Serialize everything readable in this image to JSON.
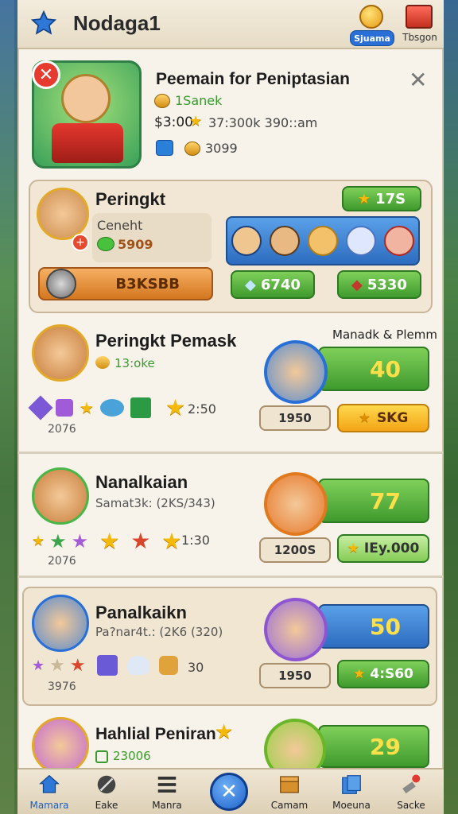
{
  "header": {
    "title": "Nodaga1",
    "btn1_label": "Sjuama",
    "btn2_label": "Tbsgon"
  },
  "card": {
    "title": "Peemain for Peniptasian",
    "coin_text": "1Sanek",
    "price": "$3:00",
    "time": "37:300k 390::am",
    "count": "3099"
  },
  "profile": {
    "name": "Peringkt",
    "sub": "Ceneht",
    "gems": "5909",
    "action": "B3KSBB",
    "stars": "17S",
    "gems_a": "6740",
    "gems_b": "5330"
  },
  "rows": [
    {
      "name": "Peringkt Pemask",
      "sub": "13:oke",
      "label_right": "Manadk & Plemm",
      "score": "40",
      "tag": "1950",
      "btn": "SKG",
      "time": "2:50",
      "rank": "2076"
    },
    {
      "name": "Nanalkaian",
      "sub": "Samat3k: (2KS/343)",
      "score": "77",
      "tag": "1200S",
      "btn": "IEy.000",
      "time": "1:30",
      "rank": "2076"
    },
    {
      "name": "Panalkaikn",
      "sub": "Pa?nar4t.: (2K6 (320)",
      "score": "50",
      "tag": "1950",
      "btn": "4:S60",
      "time": "30",
      "rank": "3976"
    },
    {
      "name": "Hahlial Peniran",
      "sub": "23006",
      "score": "29"
    }
  ],
  "nav": [
    {
      "label": "Mamara"
    },
    {
      "label": "Eake"
    },
    {
      "label": "Manra"
    },
    {
      "label": ""
    },
    {
      "label": "Camam"
    },
    {
      "label": "Moeuna"
    },
    {
      "label": "Sacke"
    }
  ],
  "colors": {
    "panel": "#f7f3ea",
    "green": "#3f9a2d",
    "gold": "#f2a516",
    "accent": "#2a6fd6"
  }
}
